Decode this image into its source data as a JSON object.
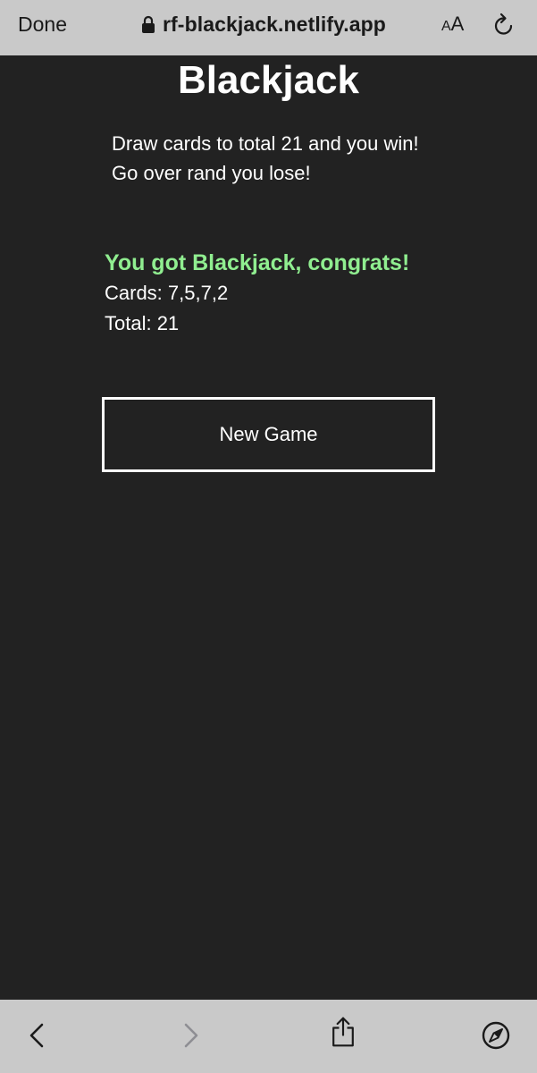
{
  "browser": {
    "done_label": "Done",
    "url": "rf-blackjack.netlify.app",
    "text_size_small": "A",
    "text_size_large": "A",
    "icons": {
      "lock": "lock-icon",
      "reload": "reload-icon",
      "back": "chevron-left-icon",
      "forward": "chevron-right-icon",
      "share": "share-icon",
      "compass": "compass-icon"
    },
    "colors": {
      "bar_background": "#c9c9c9",
      "forward_disabled": "#8e8e93"
    }
  },
  "page": {
    "title": "Blackjack",
    "instructions": [
      "Draw cards to total 21 and you win!",
      "Go over rand you lose!"
    ],
    "result": {
      "message": "You got Blackjack, congrats!",
      "cards_line": "Cards: 7,5,7,2",
      "total_line": "Total: 21"
    },
    "new_game_label": "New Game",
    "colors": {
      "background": "#222222",
      "text": "#ffffff",
      "win": "#90ee90"
    }
  }
}
